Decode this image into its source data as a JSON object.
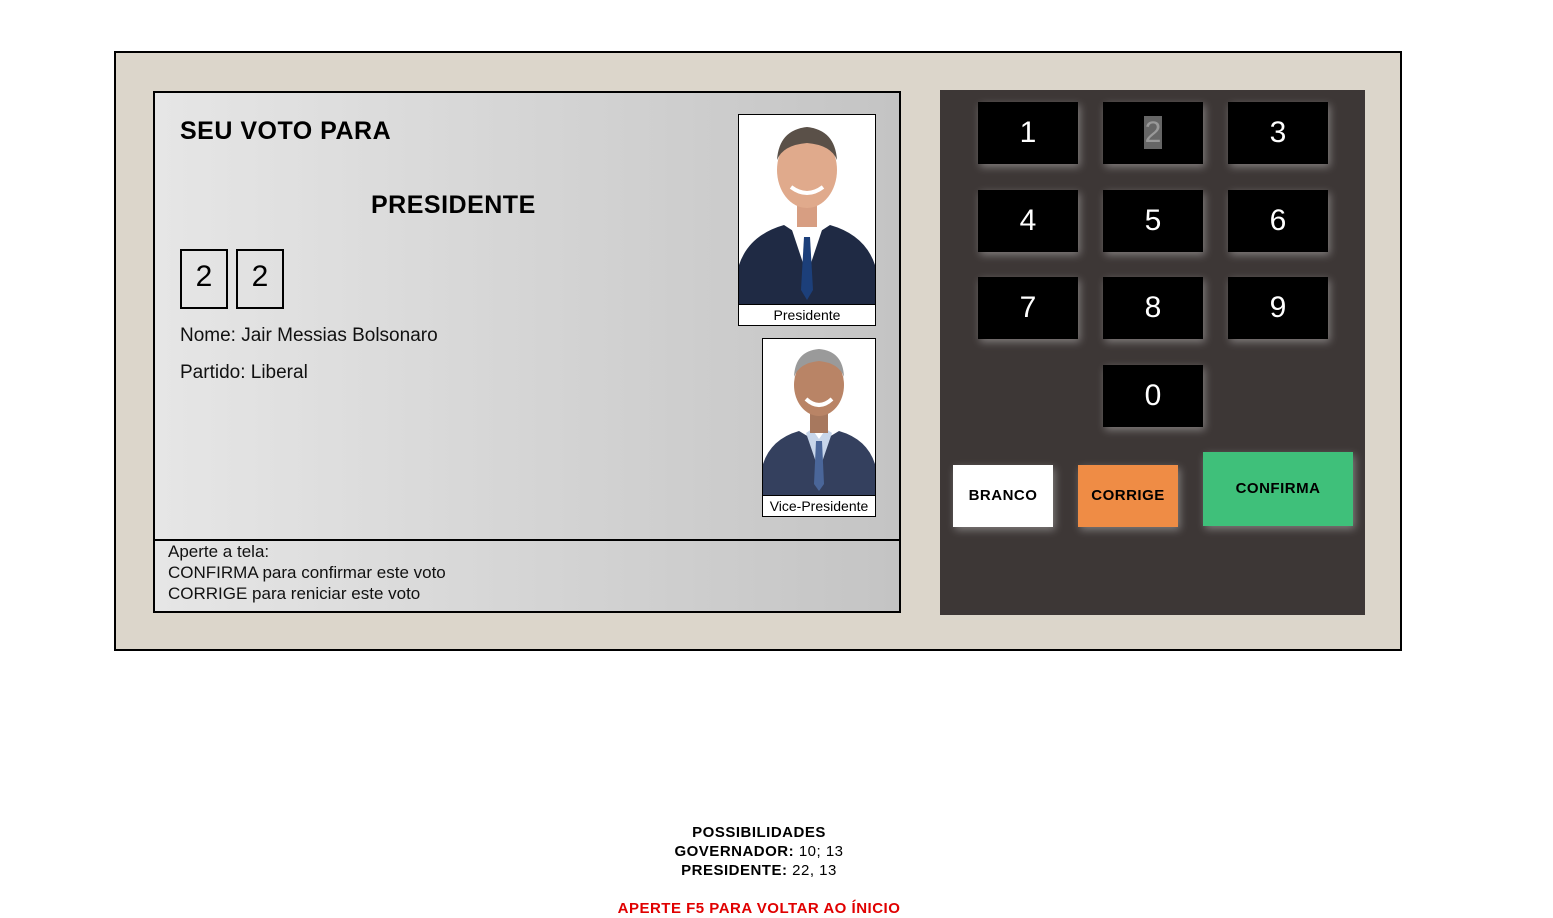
{
  "screen": {
    "header": "SEU VOTO PARA",
    "office": "PRESIDENTE",
    "digits": [
      "2",
      "2"
    ],
    "name_line": "Nome: Jair Messias Bolsonaro",
    "party_line": "Partido: Liberal",
    "photos": {
      "main_caption": "Presidente",
      "vice_caption": "Vice-Presidente"
    },
    "instructions": {
      "line1": "Aperte a tela:",
      "line2": "CONFIRMA para confirmar este voto",
      "line3": "CORRIGE para reniciar este voto"
    }
  },
  "keypad": {
    "keys": [
      "1",
      "2",
      "3",
      "4",
      "5",
      "6",
      "7",
      "8",
      "9",
      "0"
    ],
    "branco": "BRANCO",
    "corrige": "CORRIGE",
    "confirma": "CONFIRMA",
    "colors": {
      "branco": "#ffffff",
      "corrige": "#ef8c45",
      "confirma": "#3fc07a"
    }
  },
  "footer": {
    "title": "POSSIBILIDADES",
    "gov_label": "GOVERNADOR:",
    "gov_values": "10; 13",
    "pres_label": "PRESIDENTE:",
    "pres_values": "22, 13",
    "reload_notice": "APERTE F5 PARA VOLTAR AO ÍNICIO"
  }
}
